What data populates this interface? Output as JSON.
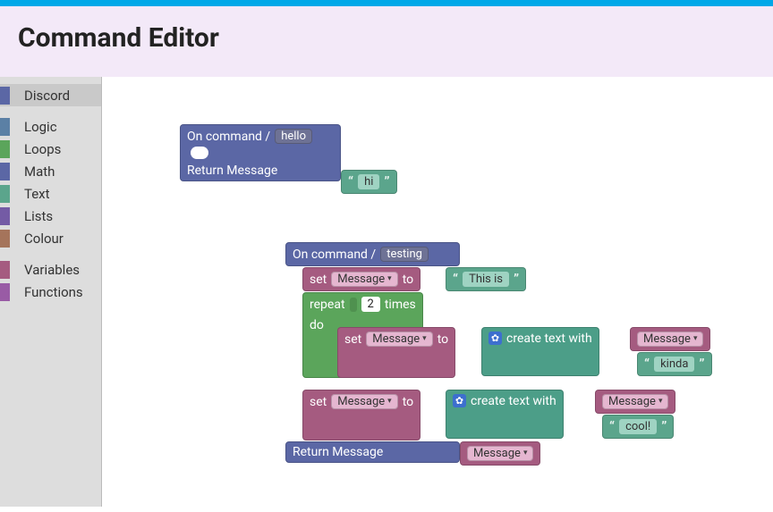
{
  "header": {
    "title": "Command Editor"
  },
  "sidebar": {
    "categories": [
      {
        "label": "Discord",
        "color": "#5b67a5",
        "active": true
      },
      {
        "label": "Logic",
        "color": "#5b80a5"
      },
      {
        "label": "Loops",
        "color": "#5ba55b"
      },
      {
        "label": "Math",
        "color": "#5b67a5"
      },
      {
        "label": "Text",
        "color": "#5ba58c"
      },
      {
        "label": "Lists",
        "color": "#745ba5"
      },
      {
        "label": "Colour",
        "color": "#a5745b"
      },
      {
        "label": "Variables",
        "color": "#a55b80"
      },
      {
        "label": "Functions",
        "color": "#995ba5"
      }
    ]
  },
  "block1": {
    "onCommandPrefix": "On command /",
    "commandName": "hello",
    "returnLabel": "Return Message",
    "returnValue": "hi"
  },
  "block2": {
    "onCommandPrefix": "On command /",
    "commandName": "testing",
    "set": "set",
    "to": "to",
    "varName": "Message",
    "initialText": "This is ",
    "repeatLabel": "repeat",
    "repeatCount": "2",
    "timesLabel": "times",
    "doLabel": "do",
    "createTextLabel": "create text with",
    "appendText1": "kinda ",
    "appendText2": " cool!",
    "returnLabel": "Return Message"
  }
}
